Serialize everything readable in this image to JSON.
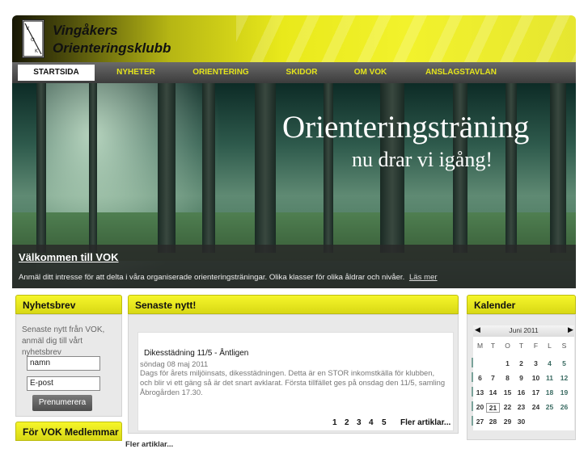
{
  "site": {
    "title_line1": "Vingåkers",
    "title_line2": "Orienteringsklubb",
    "logo_text": "VOK"
  },
  "nav": [
    {
      "label": "STARTSIDA",
      "active": true
    },
    {
      "label": "NYHETER"
    },
    {
      "label": "ORIENTERING"
    },
    {
      "label": "SKIDOR"
    },
    {
      "label": "OM VOK"
    },
    {
      "label": "ANSLAGSTAVLAN"
    }
  ],
  "hero": {
    "title": "Orienteringsträning",
    "subtitle": "nu drar vi igång!",
    "caption_title": "Välkommen till VOK",
    "caption_text": "Anmäl ditt intresse för att delta i våra organiserade orienteringsträningar. Olika klasser för olika åldrar och nivåer.",
    "read_more": "Läs mer"
  },
  "newsletter": {
    "heading": "Nyhetsbrev",
    "text_lines": [
      "Senaste nytt från VOK,",
      "anmäl dig till vårt",
      "nyhetsbrev"
    ],
    "name_value": "namn",
    "email_value": "E-post",
    "button": "Prenumerera"
  },
  "members": {
    "heading": "För VOK Medlemmar"
  },
  "news": {
    "heading": "Senaste nytt!",
    "item_title": "Dikesstädning 11/5 - Åntligen",
    "item_date": "söndag 08 maj 2011",
    "item_body": "Dags för årets miljöinsats, dikesstädningen. Detta är en STOR inkomstkälla för klubben, och blir vi ett gäng så är det snart avklarat. Första tillfället ges på onsdag den 11/5, samling Åbrogården 17.30.",
    "pages": [
      "1",
      "2",
      "3",
      "4",
      "5"
    ],
    "more": "Fler artiklar...",
    "bottom_more": "Fler artiklar..."
  },
  "calendar": {
    "heading": "Kalender",
    "month": "Juni 2011",
    "weekdays": [
      "M",
      "T",
      "O",
      "T",
      "F",
      "L",
      "S"
    ],
    "weeks": [
      [
        "",
        "",
        "1",
        "2",
        "3",
        "4",
        "5"
      ],
      [
        "6",
        "7",
        "8",
        "9",
        "10",
        "11",
        "12"
      ],
      [
        "13",
        "14",
        "15",
        "16",
        "17",
        "18",
        "19"
      ],
      [
        "20",
        "21",
        "22",
        "23",
        "24",
        "25",
        "26"
      ],
      [
        "27",
        "28",
        "29",
        "30",
        "",
        "",
        ""
      ]
    ],
    "today": "21"
  }
}
